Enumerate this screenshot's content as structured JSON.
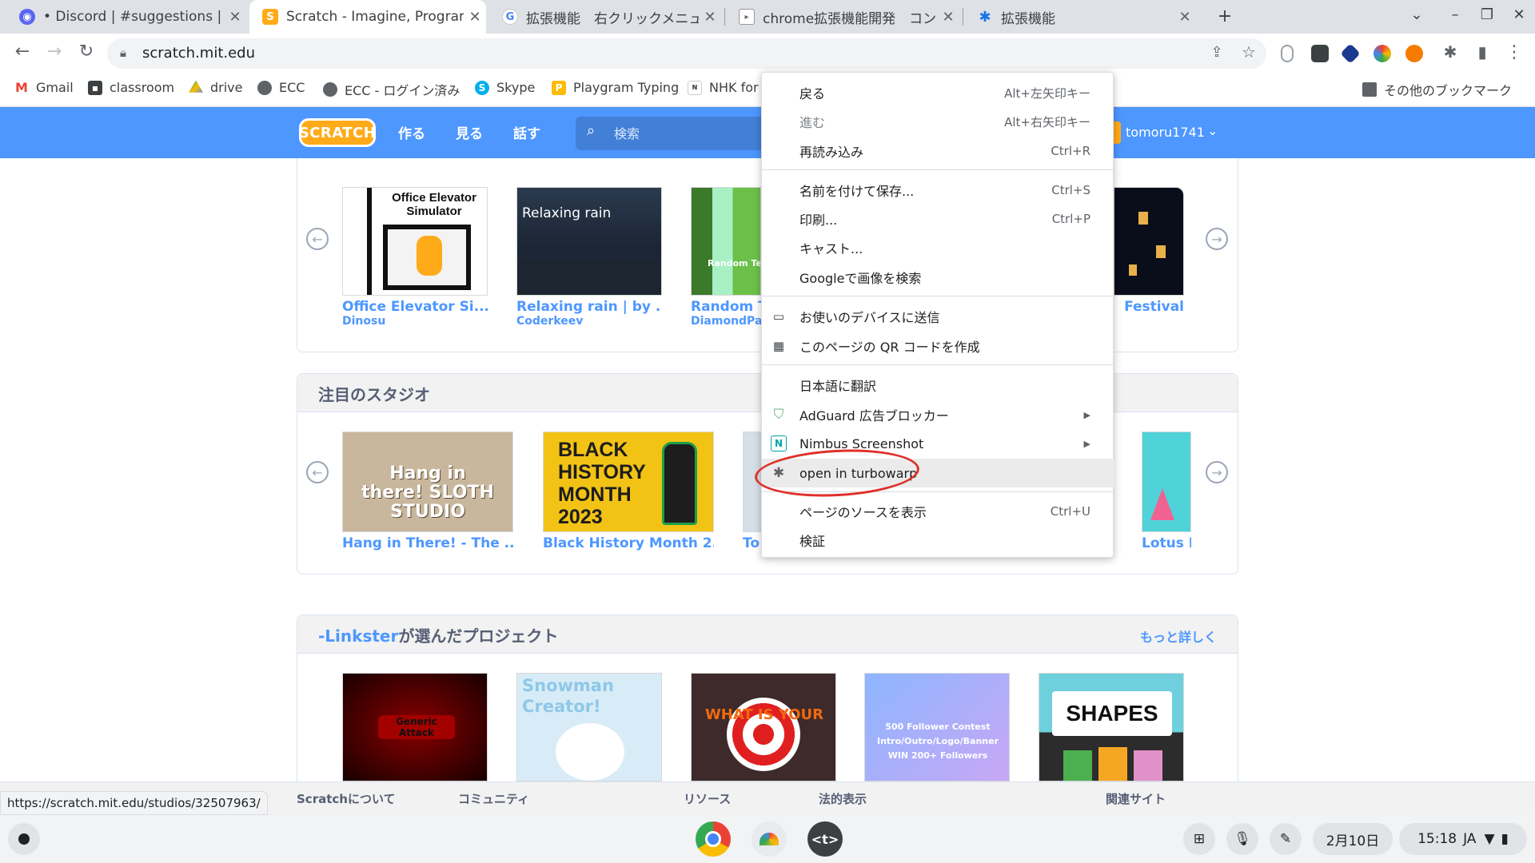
{
  "tabs": [
    {
      "title": "• Discord | #suggestions | Scratch",
      "icon": "discord-icon"
    },
    {
      "title": "Scratch - Imagine, Program, Share",
      "icon": "scratch-icon"
    },
    {
      "title": "拡張機能　右クリックメニュー",
      "icon": "google-icon"
    },
    {
      "title": "chrome拡張機能開発　コンテ",
      "icon": "page-icon"
    },
    {
      "title": "拡張機能",
      "icon": "puzzle-icon"
    }
  ],
  "toolbar": {
    "url": "scratch.mit.edu"
  },
  "bookmarks": {
    "items": [
      "Gmail",
      "classroom",
      "drive",
      "ECC",
      "ECC - ログイン済み",
      "Skype",
      "Playgram Typing",
      "NHK for"
    ],
    "other": "その他のブックマーク"
  },
  "scratch_nav": {
    "logo": "SCRATCH",
    "links": [
      "作る",
      "見る",
      "話す"
    ],
    "search_placeholder": "検索",
    "username": "tomoru1741"
  },
  "section1": {
    "cards": [
      {
        "title": "Office Elevator Si...",
        "author": "Dinosu",
        "thumb_text": "Office Elevator Simulator"
      },
      {
        "title": "Relaxing rain | by ...",
        "author": "Coderkeev",
        "thumb_text": "Relaxing rain"
      },
      {
        "title": "Random T",
        "author": "DiamondPa",
        "thumb_text": "Random Terr"
      },
      {
        "title": "Festival",
        "author": "",
        "thumb_text": ""
      }
    ]
  },
  "section2": {
    "title": "注目のスタジオ",
    "cards": [
      {
        "title": "Hang in There! - The ...",
        "thumb_text": "Hang in there! SLOTH STUDIO"
      },
      {
        "title": "Black History Month 2...",
        "thumb_text": "BLACK HISTORY MONTH 2023"
      },
      {
        "title": "To",
        "thumb_text": ""
      },
      {
        "title": "Lotus F",
        "thumb_text": ""
      }
    ]
  },
  "section3": {
    "title_user": "-Linkster",
    "title_rest": "が選んだプロジェクト",
    "more": "もっと詳しく",
    "thumbs": [
      "Generic Attack",
      "Snowman Creator!",
      "WHAT IS YOUR REACTION TIME?",
      "500 Follower Contest Intro/Outro/Logo/Banner WIN 200+ Followers",
      "SHAPES"
    ]
  },
  "footer": {
    "links": [
      "Scratchについて",
      "コミュニティ",
      "リソース",
      "法的表示",
      "関連サイト"
    ],
    "status_url": "https://scratch.mit.edu/studios/32507963/"
  },
  "shelf": {
    "date": "2月10日",
    "time": "15:18",
    "ime": "JA"
  },
  "context_menu": {
    "items": [
      {
        "label": "戻る",
        "shortcut": "Alt+左矢印キー"
      },
      {
        "label": "進む",
        "shortcut": "Alt+右矢印キー",
        "disabled": true
      },
      {
        "label": "再読み込み",
        "shortcut": "Ctrl+R"
      },
      {
        "label": "名前を付けて保存...",
        "shortcut": "Ctrl+S"
      },
      {
        "label": "印刷...",
        "shortcut": "Ctrl+P"
      },
      {
        "label": "キャスト...",
        "shortcut": ""
      },
      {
        "label": "Googleで画像を検索",
        "shortcut": ""
      },
      {
        "label": "お使いのデバイスに送信",
        "shortcut": "",
        "icon": "devices-icon"
      },
      {
        "label": "このページの QR コードを作成",
        "shortcut": "",
        "icon": "qr-code-icon"
      },
      {
        "label": "日本語に翻訳",
        "shortcut": ""
      },
      {
        "label": "AdGuard 広告ブロッカー",
        "shortcut": "",
        "icon": "adguard-shield-icon",
        "submenu": true
      },
      {
        "label": "Nimbus Screenshot",
        "shortcut": "",
        "icon": "nimbus-icon",
        "submenu": true
      },
      {
        "label": "open in turbowarp",
        "shortcut": "",
        "icon": "puzzle-icon",
        "highlighted": true
      },
      {
        "label": "ページのソースを表示",
        "shortcut": "Ctrl+U"
      },
      {
        "label": "検証",
        "shortcut": ""
      }
    ],
    "highlight_color": "#e0302a"
  }
}
